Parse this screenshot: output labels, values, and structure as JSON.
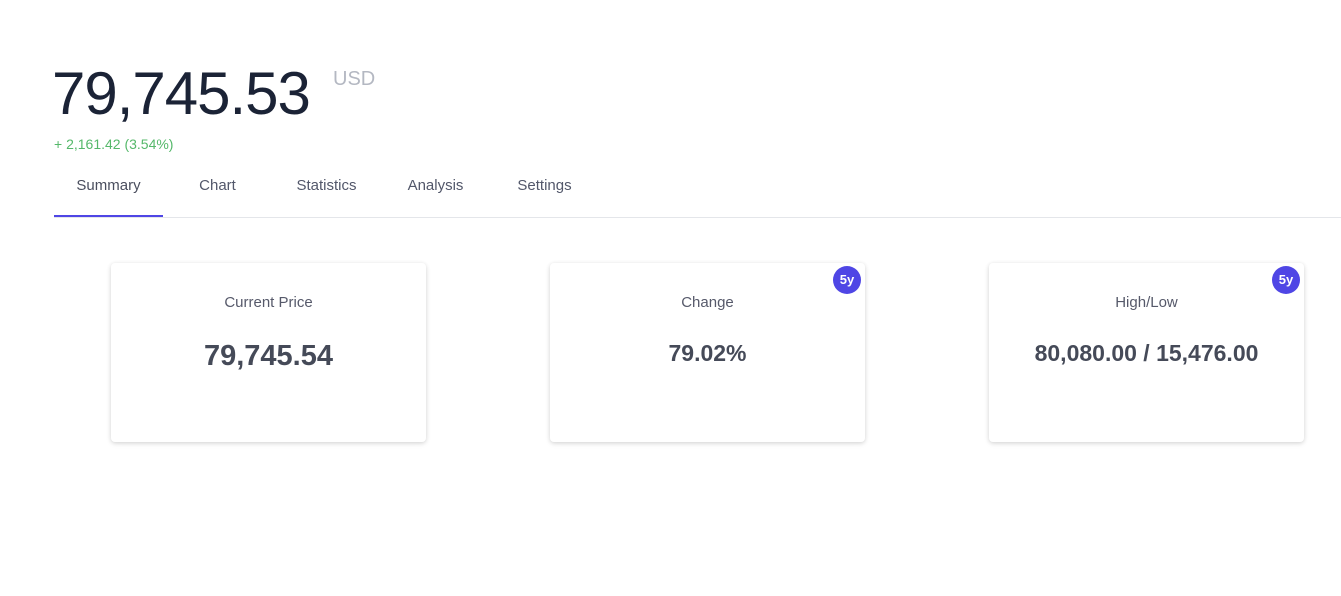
{
  "price": {
    "value": "79,745.53",
    "currency": "USD",
    "change": "+ 2,161.42 (3.54%)"
  },
  "tabs": [
    {
      "label": "Summary",
      "active": true
    },
    {
      "label": "Chart",
      "active": false
    },
    {
      "label": "Statistics",
      "active": false
    },
    {
      "label": "Analysis",
      "active": false
    },
    {
      "label": "Settings",
      "active": false
    }
  ],
  "cards": [
    {
      "label": "Current Price",
      "value": "79,745.54",
      "badge": ""
    },
    {
      "label": "Change",
      "value": "79.02%",
      "badge": "5y"
    },
    {
      "label": "High/Low",
      "value": "80,080.00 / 15,476.00",
      "badge": "5y"
    }
  ],
  "colors": {
    "accent": "#4f46e5",
    "positive": "#55b86a",
    "muted": "#b4b8c2",
    "divider": "#e4e6ea"
  }
}
